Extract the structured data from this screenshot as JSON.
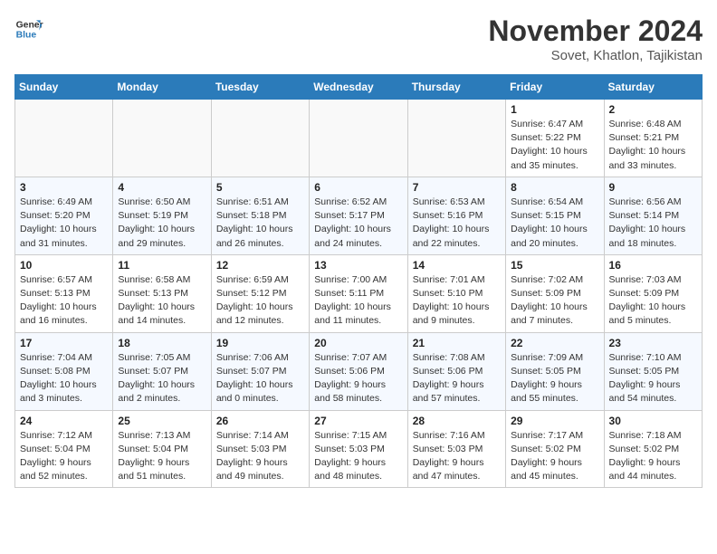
{
  "header": {
    "logo_line1": "General",
    "logo_line2": "Blue",
    "month_title": "November 2024",
    "location": "Sovet, Khatlon, Tajikistan"
  },
  "weekdays": [
    "Sunday",
    "Monday",
    "Tuesday",
    "Wednesday",
    "Thursday",
    "Friday",
    "Saturday"
  ],
  "weeks": [
    [
      {
        "day": "",
        "info": ""
      },
      {
        "day": "",
        "info": ""
      },
      {
        "day": "",
        "info": ""
      },
      {
        "day": "",
        "info": ""
      },
      {
        "day": "",
        "info": ""
      },
      {
        "day": "1",
        "info": "Sunrise: 6:47 AM\nSunset: 5:22 PM\nDaylight: 10 hours and 35 minutes."
      },
      {
        "day": "2",
        "info": "Sunrise: 6:48 AM\nSunset: 5:21 PM\nDaylight: 10 hours and 33 minutes."
      }
    ],
    [
      {
        "day": "3",
        "info": "Sunrise: 6:49 AM\nSunset: 5:20 PM\nDaylight: 10 hours and 31 minutes."
      },
      {
        "day": "4",
        "info": "Sunrise: 6:50 AM\nSunset: 5:19 PM\nDaylight: 10 hours and 29 minutes."
      },
      {
        "day": "5",
        "info": "Sunrise: 6:51 AM\nSunset: 5:18 PM\nDaylight: 10 hours and 26 minutes."
      },
      {
        "day": "6",
        "info": "Sunrise: 6:52 AM\nSunset: 5:17 PM\nDaylight: 10 hours and 24 minutes."
      },
      {
        "day": "7",
        "info": "Sunrise: 6:53 AM\nSunset: 5:16 PM\nDaylight: 10 hours and 22 minutes."
      },
      {
        "day": "8",
        "info": "Sunrise: 6:54 AM\nSunset: 5:15 PM\nDaylight: 10 hours and 20 minutes."
      },
      {
        "day": "9",
        "info": "Sunrise: 6:56 AM\nSunset: 5:14 PM\nDaylight: 10 hours and 18 minutes."
      }
    ],
    [
      {
        "day": "10",
        "info": "Sunrise: 6:57 AM\nSunset: 5:13 PM\nDaylight: 10 hours and 16 minutes."
      },
      {
        "day": "11",
        "info": "Sunrise: 6:58 AM\nSunset: 5:13 PM\nDaylight: 10 hours and 14 minutes."
      },
      {
        "day": "12",
        "info": "Sunrise: 6:59 AM\nSunset: 5:12 PM\nDaylight: 10 hours and 12 minutes."
      },
      {
        "day": "13",
        "info": "Sunrise: 7:00 AM\nSunset: 5:11 PM\nDaylight: 10 hours and 11 minutes."
      },
      {
        "day": "14",
        "info": "Sunrise: 7:01 AM\nSunset: 5:10 PM\nDaylight: 10 hours and 9 minutes."
      },
      {
        "day": "15",
        "info": "Sunrise: 7:02 AM\nSunset: 5:09 PM\nDaylight: 10 hours and 7 minutes."
      },
      {
        "day": "16",
        "info": "Sunrise: 7:03 AM\nSunset: 5:09 PM\nDaylight: 10 hours and 5 minutes."
      }
    ],
    [
      {
        "day": "17",
        "info": "Sunrise: 7:04 AM\nSunset: 5:08 PM\nDaylight: 10 hours and 3 minutes."
      },
      {
        "day": "18",
        "info": "Sunrise: 7:05 AM\nSunset: 5:07 PM\nDaylight: 10 hours and 2 minutes."
      },
      {
        "day": "19",
        "info": "Sunrise: 7:06 AM\nSunset: 5:07 PM\nDaylight: 10 hours and 0 minutes."
      },
      {
        "day": "20",
        "info": "Sunrise: 7:07 AM\nSunset: 5:06 PM\nDaylight: 9 hours and 58 minutes."
      },
      {
        "day": "21",
        "info": "Sunrise: 7:08 AM\nSunset: 5:06 PM\nDaylight: 9 hours and 57 minutes."
      },
      {
        "day": "22",
        "info": "Sunrise: 7:09 AM\nSunset: 5:05 PM\nDaylight: 9 hours and 55 minutes."
      },
      {
        "day": "23",
        "info": "Sunrise: 7:10 AM\nSunset: 5:05 PM\nDaylight: 9 hours and 54 minutes."
      }
    ],
    [
      {
        "day": "24",
        "info": "Sunrise: 7:12 AM\nSunset: 5:04 PM\nDaylight: 9 hours and 52 minutes."
      },
      {
        "day": "25",
        "info": "Sunrise: 7:13 AM\nSunset: 5:04 PM\nDaylight: 9 hours and 51 minutes."
      },
      {
        "day": "26",
        "info": "Sunrise: 7:14 AM\nSunset: 5:03 PM\nDaylight: 9 hours and 49 minutes."
      },
      {
        "day": "27",
        "info": "Sunrise: 7:15 AM\nSunset: 5:03 PM\nDaylight: 9 hours and 48 minutes."
      },
      {
        "day": "28",
        "info": "Sunrise: 7:16 AM\nSunset: 5:03 PM\nDaylight: 9 hours and 47 minutes."
      },
      {
        "day": "29",
        "info": "Sunrise: 7:17 AM\nSunset: 5:02 PM\nDaylight: 9 hours and 45 minutes."
      },
      {
        "day": "30",
        "info": "Sunrise: 7:18 AM\nSunset: 5:02 PM\nDaylight: 9 hours and 44 minutes."
      }
    ]
  ]
}
